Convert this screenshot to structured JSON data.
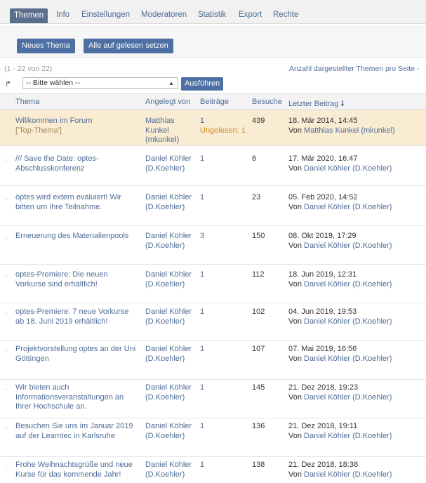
{
  "tabs": [
    {
      "label": "Themen"
    },
    {
      "label": "Info"
    },
    {
      "label": "Einstellungen"
    },
    {
      "label": "Moderatoren"
    },
    {
      "label": "Statistik"
    },
    {
      "label": "Export"
    },
    {
      "label": "Rechte"
    }
  ],
  "toolbar": {
    "new_topic": "Neues Thema",
    "mark_all_read": "Alle auf gelesen setzen"
  },
  "list_meta": {
    "range": "(1 - 22 von 22)",
    "per_page": "Anzahl dargestellter Themen pro Seite -"
  },
  "command": {
    "select_value": "-- Bitte wählen --",
    "execute_label": "Ausführen"
  },
  "columns": {
    "topic": "Thema",
    "author": "Angelegt von",
    "posts": "Beiträge",
    "visits": "Besuche",
    "last_post": "Letzter Beitrag"
  },
  "rows": [
    {
      "title": "Willkommen im Forum",
      "sub": "['Top-Thema']",
      "author": "Matthias Kunkel (mkunkel)",
      "posts": "1",
      "unread": "Ungelesen: 1",
      "visits": "439",
      "date": "18. Mär 2014, 14:45",
      "by_prefix": "Von",
      "by_user": "Matthias Kunkel (mkunkel)"
    },
    {
      "title": "/// Save the Date: optes-Abschlusskonferenz",
      "author": "Daniel Köhler (D.Koehler)",
      "posts": "1",
      "visits": "6",
      "date": "17. Mär 2020, 16:47",
      "by_prefix": "Von",
      "by_user": "Daniel Köhler (D.Koehler)"
    },
    {
      "title": "optes wird extern evaluiert! Wir bitten um Ihre Teilnahme.",
      "author": "Daniel Köhler (D.Koehler)",
      "posts": "1",
      "visits": "23",
      "date": "05. Feb 2020, 14:52",
      "by_prefix": "Von",
      "by_user": "Daniel Köhler (D.Koehler)"
    },
    {
      "title": "Erneuerung des Materialienpools",
      "author": "Daniel Köhler (D.Koehler)",
      "posts": "3",
      "visits": "150",
      "date": "08. Okt 2019, 17:29",
      "by_prefix": "Von",
      "by_user": "Daniel Köhler (D.Koehler)"
    },
    {
      "title": "optes-Premiere: Die neuen Vorkurse sind erhältlich!",
      "author": "Daniel Köhler (D.Koehler)",
      "posts": "1",
      "visits": "112",
      "date": "18. Jun 2019, 12:31",
      "by_prefix": "Von",
      "by_user": "Daniel Köhler (D.Koehler)"
    },
    {
      "title": "optes-Premiere: 7 neue Vorkurse ab 18. Juni 2019 erhältlich!",
      "author": "Daniel Köhler (D.Koehler)",
      "posts": "1",
      "visits": "102",
      "date": "04. Jun 2019, 19:53",
      "by_prefix": "Von",
      "by_user": "Daniel Köhler (D.Koehler)"
    },
    {
      "title": "Projektvorstellung optes an der Uni Göttingen",
      "author": "Daniel Köhler (D.Koehler)",
      "posts": "1",
      "visits": "107",
      "date": "07. Mai 2019, 16:56",
      "by_prefix": "Von",
      "by_user": "Daniel Köhler (D.Koehler)"
    },
    {
      "title": "Wir bieten auch Informationsveranstaltungen an Ihrer Hochschule an.",
      "author": "Daniel Köhler (D.Koehler)",
      "posts": "1",
      "visits": "145",
      "date": "21. Dez 2018, 19:23",
      "by_prefix": "Von",
      "by_user": "Daniel Köhler (D.Koehler)"
    },
    {
      "title": "Besuchen Sie uns im Januar 2019 auf der Learntec in Karlsruhe",
      "author": "Daniel Köhler (D.Koehler)",
      "posts": "1",
      "visits": "136",
      "date": "21. Dez 2018, 19:11",
      "by_prefix": "Von",
      "by_user": "Daniel Köhler (D.Koehler)"
    },
    {
      "title": "Frohe Weihnachtsgrüße und neue Kurse für das kommende Jahr!",
      "author": "Daniel Köhler (D.Koehler)",
      "posts": "1",
      "visits": "138",
      "date": "21. Dez 2018, 18:38",
      "by_prefix": "Von",
      "by_user": "Daniel Köhler (D.Koehler)"
    }
  ]
}
